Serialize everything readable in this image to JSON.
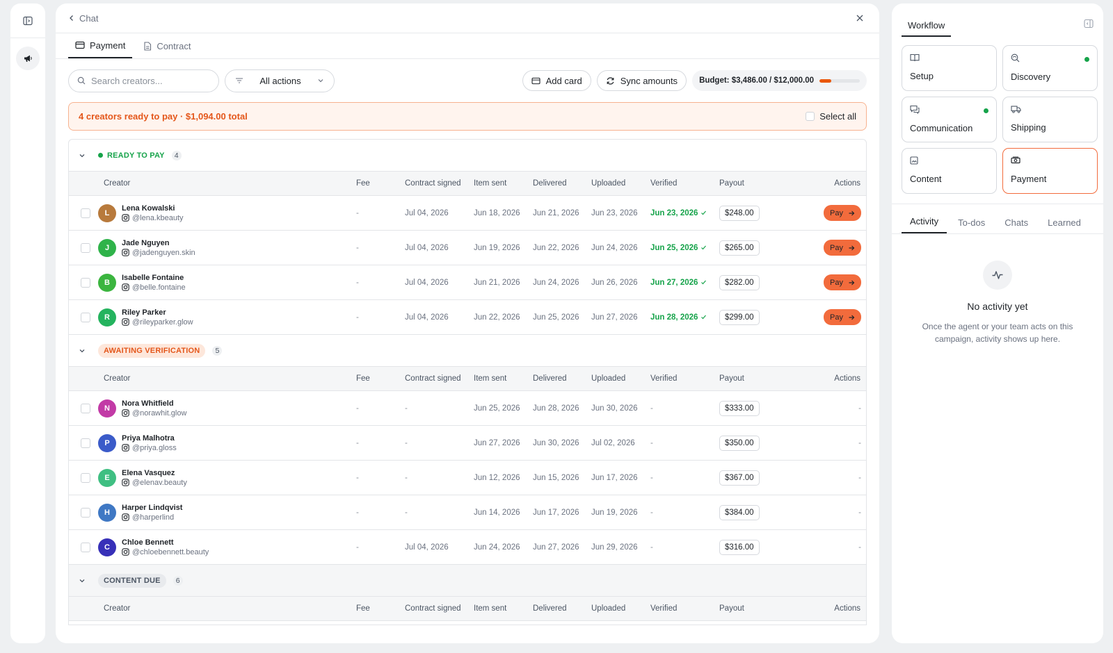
{
  "header": {
    "back_label": "Chat"
  },
  "tabs": [
    {
      "label": "Payment",
      "icon": "credit-card-icon"
    },
    {
      "label": "Contract",
      "icon": "document-icon"
    }
  ],
  "toolbar": {
    "search_placeholder": "Search creators...",
    "filter_value": "All actions",
    "add_card_label": "Add card",
    "sync_label": "Sync amounts",
    "budget_label": "Budget: $3,486.00 / $12,000.00",
    "budget_fraction": 0.29
  },
  "banner": {
    "text": "4 creators ready to pay · $1,094.00 total",
    "select_all_label": "Select all"
  },
  "columns": [
    "Creator",
    "Fee",
    "Contract signed",
    "Item sent",
    "Delivered",
    "Uploaded",
    "Verified",
    "Payout",
    "Actions"
  ],
  "groups": [
    {
      "status": "READY TO PAY",
      "count": "4",
      "rows": [
        {
          "initial": "L",
          "color": "#b87a3c",
          "name": "Lena Kowalski",
          "handle": "@lena.kbeauty",
          "fee": "-",
          "contract": "Jul 04, 2026",
          "sent": "Jun 18, 2026",
          "delivered": "Jun 21, 2026",
          "uploaded": "Jun 23, 2026",
          "verified": "Jun 23, 2026",
          "payout": "$248.00",
          "action": "Pay"
        },
        {
          "initial": "J",
          "color": "#2fb34a",
          "name": "Jade Nguyen",
          "handle": "@jadenguyen.skin",
          "fee": "-",
          "contract": "Jul 04, 2026",
          "sent": "Jun 19, 2026",
          "delivered": "Jun 22, 2026",
          "uploaded": "Jun 24, 2026",
          "verified": "Jun 25, 2026",
          "payout": "$265.00",
          "action": "Pay"
        },
        {
          "initial": "B",
          "color": "#3bb53f",
          "name": "Isabelle Fontaine",
          "handle": "@belle.fontaine",
          "fee": "-",
          "contract": "Jul 04, 2026",
          "sent": "Jun 21, 2026",
          "delivered": "Jun 24, 2026",
          "uploaded": "Jun 26, 2026",
          "verified": "Jun 27, 2026",
          "payout": "$282.00",
          "action": "Pay"
        },
        {
          "initial": "R",
          "color": "#24b35e",
          "name": "Riley Parker",
          "handle": "@rileyparker.glow",
          "fee": "-",
          "contract": "Jul 04, 2026",
          "sent": "Jun 22, 2026",
          "delivered": "Jun 25, 2026",
          "uploaded": "Jun 27, 2026",
          "verified": "Jun 28, 2026",
          "payout": "$299.00",
          "action": "Pay"
        }
      ]
    },
    {
      "status": "AWAITING VERIFICATION",
      "count": "5",
      "rows": [
        {
          "initial": "N",
          "color": "#c23aa6",
          "name": "Nora Whitfield",
          "handle": "@norawhit.glow",
          "fee": "-",
          "contract": "-",
          "sent": "Jun 25, 2026",
          "delivered": "Jun 28, 2026",
          "uploaded": "Jun 30, 2026",
          "verified": "-",
          "payout": "$333.00",
          "action": "-"
        },
        {
          "initial": "P",
          "color": "#3b5bc9",
          "name": "Priya Malhotra",
          "handle": "@priya.gloss",
          "fee": "-",
          "contract": "-",
          "sent": "Jun 27, 2026",
          "delivered": "Jun 30, 2026",
          "uploaded": "Jul 02, 2026",
          "verified": "-",
          "payout": "$350.00",
          "action": "-"
        },
        {
          "initial": "E",
          "color": "#3fbf82",
          "name": "Elena Vasquez",
          "handle": "@elenav.beauty",
          "fee": "-",
          "contract": "-",
          "sent": "Jun 12, 2026",
          "delivered": "Jun 15, 2026",
          "uploaded": "Jun 17, 2026",
          "verified": "-",
          "payout": "$367.00",
          "action": "-"
        },
        {
          "initial": "H",
          "color": "#3f78c4",
          "name": "Harper Lindqvist",
          "handle": "@harperlind",
          "fee": "-",
          "contract": "-",
          "sent": "Jun 14, 2026",
          "delivered": "Jun 17, 2026",
          "uploaded": "Jun 19, 2026",
          "verified": "-",
          "payout": "$384.00",
          "action": "-"
        },
        {
          "initial": "C",
          "color": "#3730b8",
          "name": "Chloe Bennett",
          "handle": "@chloebennett.beauty",
          "fee": "-",
          "contract": "Jul 04, 2026",
          "sent": "Jun 24, 2026",
          "delivered": "Jun 27, 2026",
          "uploaded": "Jun 29, 2026",
          "verified": "-",
          "payout": "$316.00",
          "action": "-"
        }
      ]
    },
    {
      "status": "CONTENT DUE",
      "count": "6",
      "rows": []
    }
  ],
  "side": {
    "title": "Workflow",
    "cards": [
      {
        "label": "Setup",
        "icon": "book-icon",
        "dot": false,
        "active": false
      },
      {
        "label": "Discovery",
        "icon": "search-globe-icon",
        "dot": true,
        "active": false
      },
      {
        "label": "Communication",
        "icon": "chat-icon",
        "dot": true,
        "active": false
      },
      {
        "label": "Shipping",
        "icon": "truck-icon",
        "dot": false,
        "active": false
      },
      {
        "label": "Content",
        "icon": "image-icon",
        "dot": false,
        "active": false
      },
      {
        "label": "Payment",
        "icon": "money-icon",
        "dot": false,
        "active": true
      }
    ],
    "activity_tabs": [
      "Activity",
      "To-dos",
      "Chats",
      "Learned"
    ],
    "empty_title": "No activity yet",
    "empty_desc": "Once the agent or your team acts on this campaign, activity shows up here."
  },
  "colors": {
    "accent": "#f26b3c",
    "success": "#16a34a",
    "warning": "#e4571b"
  }
}
